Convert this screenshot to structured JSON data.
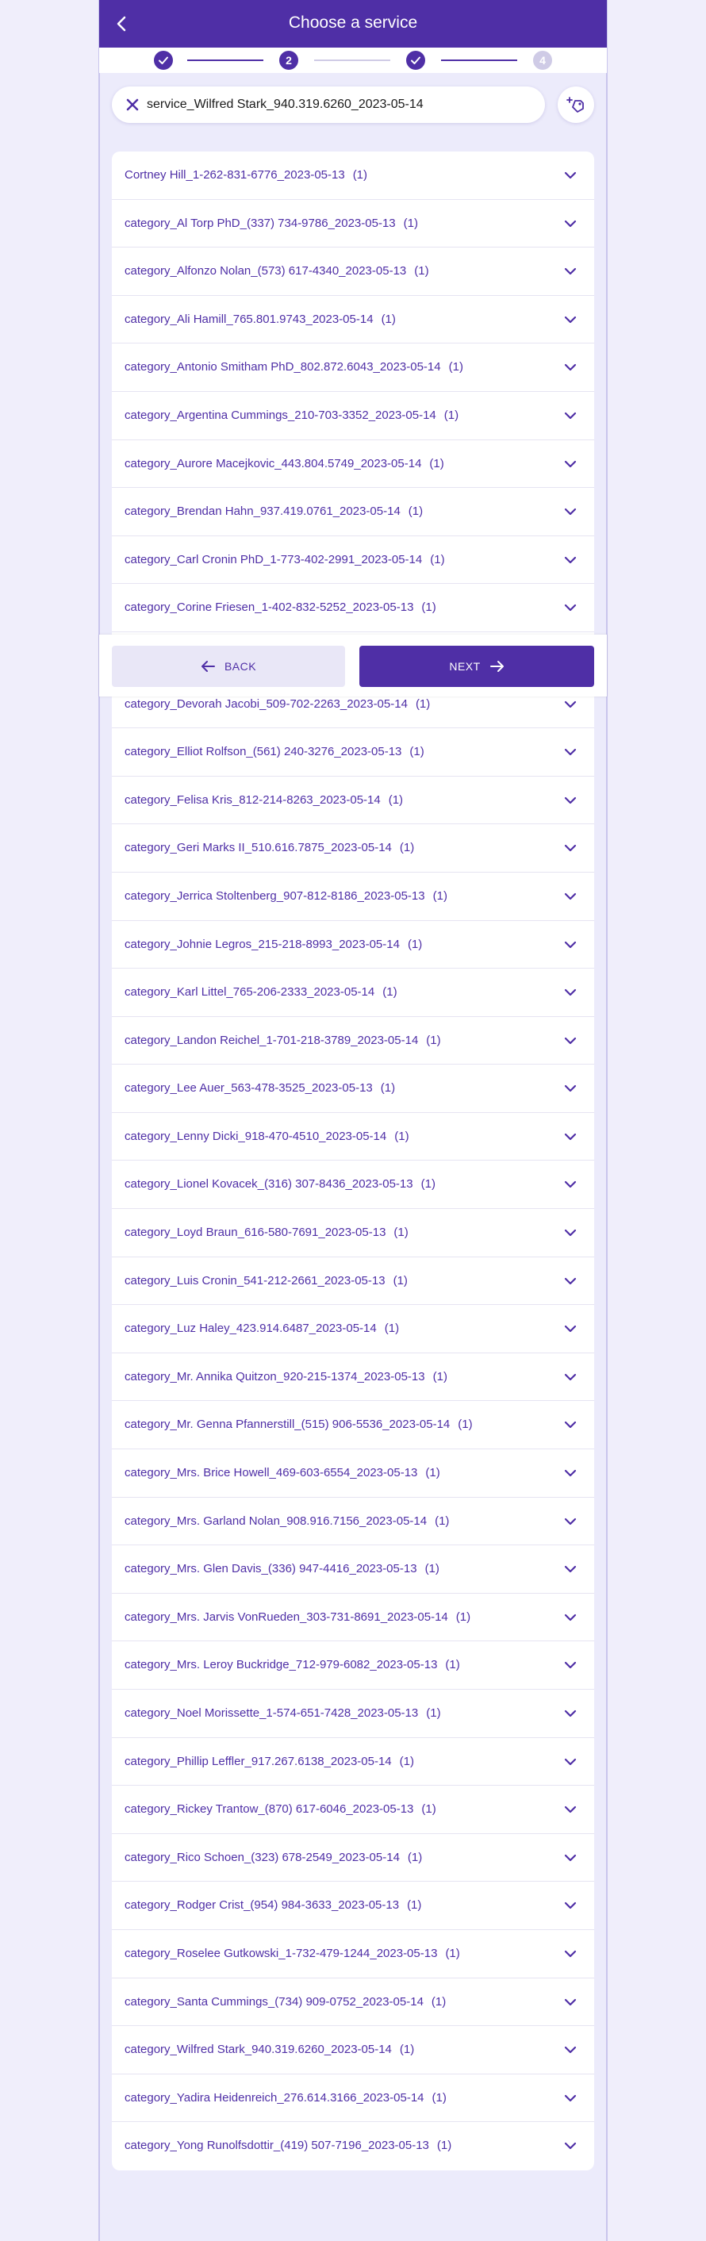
{
  "header": {
    "title": "Choose a service",
    "back_icon": "chevron-left-icon"
  },
  "stepper": {
    "steps": [
      {
        "state": "done",
        "label": ""
      },
      {
        "state": "active",
        "label": "2"
      },
      {
        "state": "done",
        "label": ""
      },
      {
        "state": "pending",
        "label": "4"
      }
    ]
  },
  "search": {
    "value": "service_Wilfred Stark_940.319.6260_2023-05-14",
    "clear_icon": "close-icon"
  },
  "tag_button": {
    "icon": "tag-add-icon"
  },
  "list": {
    "items": [
      {
        "label": "Cortney Hill_1-262-831-6776_2023-05-13",
        "count": "(1)"
      },
      {
        "label": "category_Al Torp PhD_(337) 734-9786_2023-05-13",
        "count": "(1)"
      },
      {
        "label": "category_Alfonzo Nolan_(573) 617-4340_2023-05-13",
        "count": "(1)"
      },
      {
        "label": "category_Ali Hamill_765.801.9743_2023-05-14",
        "count": "(1)"
      },
      {
        "label": "category_Antonio Smitham PhD_802.872.6043_2023-05-14",
        "count": "(1)"
      },
      {
        "label": "category_Argentina Cummings_210-703-3352_2023-05-14",
        "count": "(1)"
      },
      {
        "label": "category_Aurore Macejkovic_443.804.5749_2023-05-14",
        "count": "(1)"
      },
      {
        "label": "category_Brendan Hahn_937.419.0761_2023-05-14",
        "count": "(1)"
      },
      {
        "label": "category_Carl Cronin PhD_1-773-402-2991_2023-05-14",
        "count": "(1)"
      },
      {
        "label": "category_Corine Friesen_1-402-832-5252_2023-05-13",
        "count": "(1)"
      },
      {
        "label": "",
        "count": ""
      },
      {
        "label": "category_Devorah Jacobi_509-702-2263_2023-05-14",
        "count": "(1)"
      },
      {
        "label": "category_Elliot Rolfson_(561) 240-3276_2023-05-13",
        "count": "(1)"
      },
      {
        "label": "category_Felisa Kris_812-214-8263_2023-05-14",
        "count": "(1)"
      },
      {
        "label": "category_Geri Marks II_510.616.7875_2023-05-14",
        "count": "(1)"
      },
      {
        "label": "category_Jerrica Stoltenberg_907-812-8186_2023-05-13",
        "count": "(1)"
      },
      {
        "label": "category_Johnie Legros_215-218-8993_2023-05-14",
        "count": "(1)"
      },
      {
        "label": "category_Karl Littel_765-206-2333_2023-05-14",
        "count": "(1)"
      },
      {
        "label": "category_Landon Reichel_1-701-218-3789_2023-05-14",
        "count": "(1)"
      },
      {
        "label": "category_Lee Auer_563-478-3525_2023-05-13",
        "count": "(1)"
      },
      {
        "label": "category_Lenny Dicki_918-470-4510_2023-05-14",
        "count": "(1)"
      },
      {
        "label": "category_Lionel Kovacek_(316) 307-8436_2023-05-13",
        "count": "(1)"
      },
      {
        "label": "category_Loyd Braun_616-580-7691_2023-05-13",
        "count": "(1)"
      },
      {
        "label": "category_Luis Cronin_541-212-2661_2023-05-13",
        "count": "(1)"
      },
      {
        "label": "category_Luz Haley_423.914.6487_2023-05-14",
        "count": "(1)"
      },
      {
        "label": "category_Mr. Annika Quitzon_920-215-1374_2023-05-13",
        "count": "(1)"
      },
      {
        "label": "category_Mr. Genna Pfannerstill_(515) 906-5536_2023-05-14",
        "count": "(1)"
      },
      {
        "label": "category_Mrs. Brice Howell_469-603-6554_2023-05-13",
        "count": "(1)"
      },
      {
        "label": "category_Mrs. Garland Nolan_908.916.7156_2023-05-14",
        "count": "(1)"
      },
      {
        "label": "category_Mrs. Glen Davis_(336) 947-4416_2023-05-13",
        "count": "(1)"
      },
      {
        "label": "category_Mrs. Jarvis VonRueden_303-731-8691_2023-05-14",
        "count": "(1)"
      },
      {
        "label": "category_Mrs. Leroy Buckridge_712-979-6082_2023-05-13",
        "count": "(1)"
      },
      {
        "label": "category_Noel Morissette_1-574-651-7428_2023-05-13",
        "count": "(1)"
      },
      {
        "label": "category_Phillip Leffler_917.267.6138_2023-05-14",
        "count": "(1)"
      },
      {
        "label": "category_Rickey Trantow_(870) 617-6046_2023-05-13",
        "count": "(1)"
      },
      {
        "label": "category_Rico Schoen_(323) 678-2549_2023-05-14",
        "count": "(1)"
      },
      {
        "label": "category_Rodger Crist_(954) 984-3633_2023-05-13",
        "count": "(1)"
      },
      {
        "label": "category_Roselee Gutkowski_1-732-479-1244_2023-05-13",
        "count": "(1)"
      },
      {
        "label": "category_Santa Cummings_(734) 909-0752_2023-05-14",
        "count": "(1)"
      },
      {
        "label": "category_Wilfred Stark_940.319.6260_2023-05-14",
        "count": "(1)"
      },
      {
        "label": "category_Yadira Heidenreich_276.614.3166_2023-05-14",
        "count": "(1)"
      },
      {
        "label": "category_Yong Runolfsdottir_(419) 507-7196_2023-05-13",
        "count": "(1)"
      }
    ]
  },
  "nav": {
    "back_label": "BACK",
    "next_label": "NEXT"
  },
  "colors": {
    "primary": "#4f2fa6",
    "background": "#ecebfb",
    "pending_step": "#cfcbe6"
  }
}
